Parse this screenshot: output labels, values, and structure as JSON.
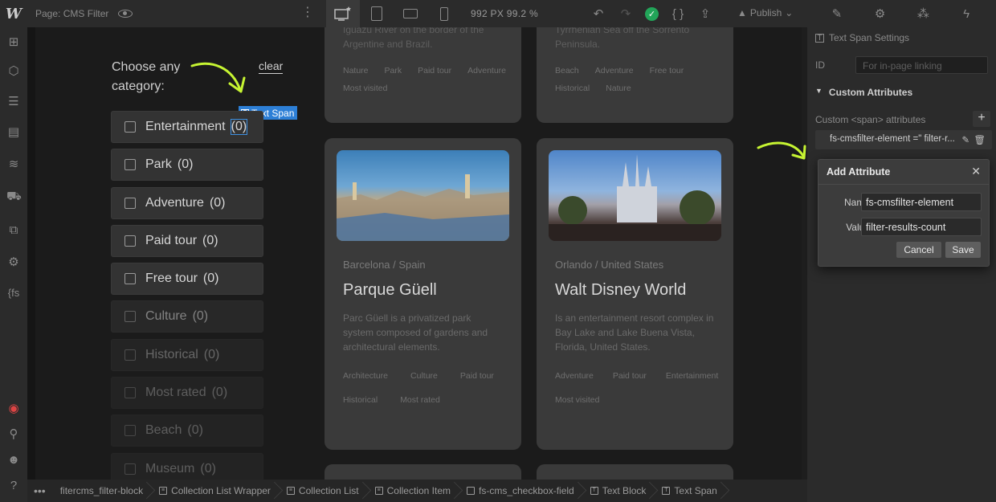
{
  "topbar": {
    "logo": "W",
    "page_label": "Page: CMS Filter",
    "size_readout": "992 PX  99.2 %",
    "publish_label": "Publish",
    "kebab": "⋮"
  },
  "canvas": {
    "choose_text": "Choose any category:",
    "clear_label": "clear",
    "text_span_tag": "Text Span",
    "filters": [
      {
        "label": "Entertainment",
        "count": "(0)"
      },
      {
        "label": "Park",
        "count": "(0)"
      },
      {
        "label": "Adventure",
        "count": "(0)"
      },
      {
        "label": "Paid tour",
        "count": "(0)"
      },
      {
        "label": "Free tour",
        "count": "(0)"
      },
      {
        "label": "Culture",
        "count": "(0)"
      },
      {
        "label": "Historical",
        "count": "(0)"
      },
      {
        "label": "Most rated",
        "count": "(0)"
      },
      {
        "label": "Beach",
        "count": "(0)"
      },
      {
        "label": "Museum",
        "count": "(0)"
      }
    ],
    "top_cards": [
      {
        "desc": "Iguazú River on the border of the Argentine and Brazil.",
        "tags": [
          "Nature",
          "Park",
          "Paid tour",
          "Adventure",
          "Most visited"
        ]
      },
      {
        "desc": "Tyrrhenian Sea off the Sorrento Peninsula.",
        "tags": [
          "Beach",
          "Adventure",
          "Free tour",
          "Historical",
          "Nature"
        ]
      }
    ],
    "cards": [
      {
        "location": "Barcelona  /  Spain",
        "title": "Parque Güell",
        "desc": "Parc Güell is a privatized park system composed of gardens and architectural elements.",
        "tags": [
          "Architecture",
          "Culture",
          "Paid tour",
          "Historical",
          "Most rated"
        ]
      },
      {
        "location": "Orlando  /  United States",
        "title": "Walt Disney World",
        "desc": "Is an entertainment resort complex in Bay Lake and Lake Buena Vista, Florida, United States.",
        "tags": [
          "Adventure",
          "Paid tour",
          "Entertainment",
          "Most visited"
        ]
      }
    ]
  },
  "panel": {
    "settings_title": "Text Span Settings",
    "id_label": "ID",
    "id_placeholder": "For in-page linking",
    "custom_attrs_title": "Custom Attributes",
    "custom_attrs_sub": "Custom <span> attributes",
    "add_icon": "+",
    "attr_row": "fs-cmsfilter-element =\" filter-r...",
    "dialog": {
      "title": "Add Attribute",
      "name_label": "Name",
      "name_value": "fs-cmsfilter-element",
      "value_label": "Value",
      "value_value": "filter-results-count",
      "cancel": "Cancel",
      "save": "Save"
    }
  },
  "breadcrumbs": [
    "fitercms_filter-block",
    "Collection List Wrapper",
    "Collection List",
    "Collection Item",
    "fs-cms_checkbox-field",
    "Text Block",
    "Text Span"
  ],
  "colors": {
    "accent_blue": "#2d7fd6",
    "arrow_green": "#c6f432",
    "success_green": "#22a559"
  }
}
